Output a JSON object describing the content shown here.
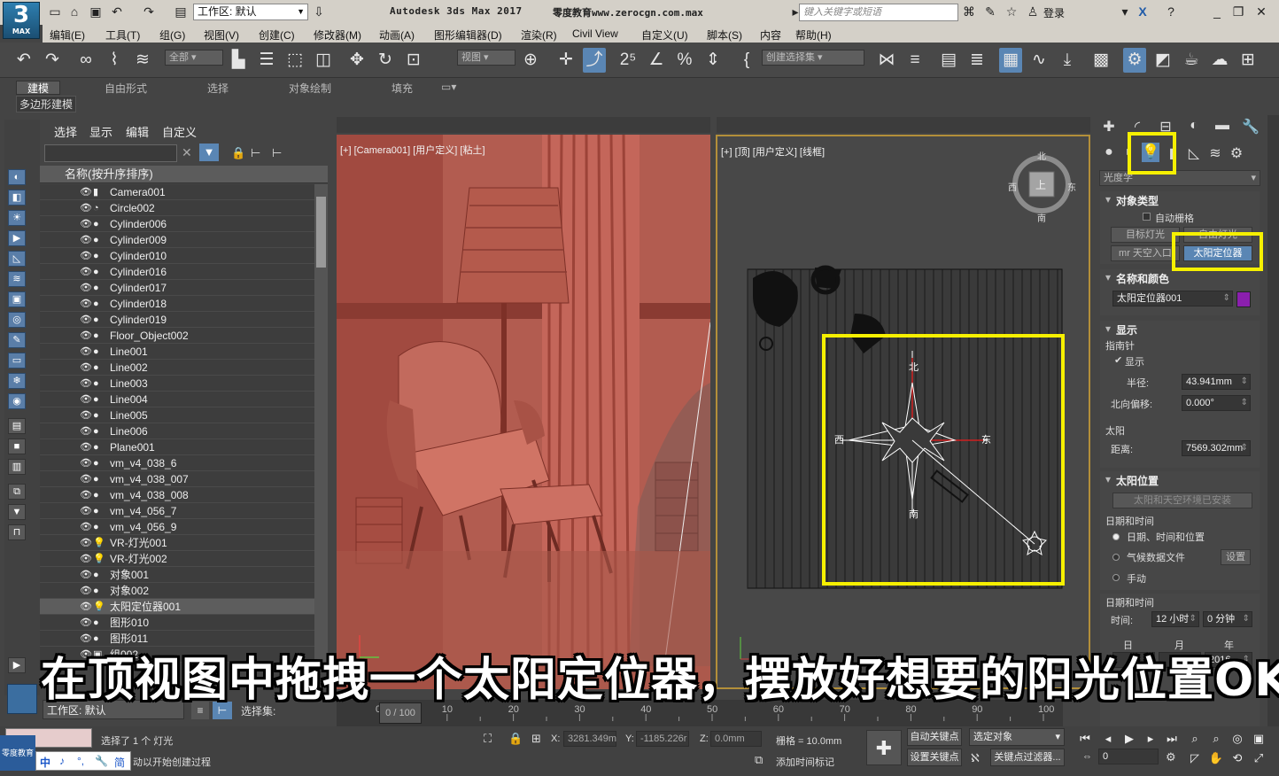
{
  "title_bar": {
    "logo_number": "3",
    "logo_sub": "MAX",
    "workspace_label": "工作区: 默认",
    "app_title": "Autodesk 3ds Max 2017",
    "site_title": "零度教育www.zerocgn.com.max",
    "search_placeholder": "键入关键字或短语",
    "login_label": "登录"
  },
  "menu": [
    "编辑(E)",
    "工具(T)",
    "组(G)",
    "视图(V)",
    "创建(C)",
    "修改器(M)",
    "动画(A)",
    "图形编辑器(D)",
    "渲染(R)",
    "Civil View",
    "自定义(U)",
    "脚本(S)",
    "内容",
    "帮助(H)"
  ],
  "toolbar": {
    "selection_filter": "全部",
    "coord_system": "视图",
    "selection_set": "创建选择集"
  },
  "ribbon": {
    "tabs": [
      "建模",
      "自由形式",
      "选择",
      "对象绘制",
      "填充"
    ],
    "active_tab": "建模",
    "sub_label": "多边形建模"
  },
  "explorer": {
    "menu": [
      "选择",
      "显示",
      "编辑",
      "自定义"
    ],
    "column_header": "名称(按升序排序)",
    "objects": [
      {
        "name": "Camera001",
        "type": "camera"
      },
      {
        "name": "Circle002",
        "type": "shape"
      },
      {
        "name": "Cylinder006",
        "type": "geometry"
      },
      {
        "name": "Cylinder009",
        "type": "geometry"
      },
      {
        "name": "Cylinder010",
        "type": "geometry"
      },
      {
        "name": "Cylinder016",
        "type": "geometry"
      },
      {
        "name": "Cylinder017",
        "type": "geometry"
      },
      {
        "name": "Cylinder018",
        "type": "geometry"
      },
      {
        "name": "Cylinder019",
        "type": "geometry"
      },
      {
        "name": "Floor_Object002",
        "type": "geometry"
      },
      {
        "name": "Line001",
        "type": "geometry"
      },
      {
        "name": "Line002",
        "type": "geometry"
      },
      {
        "name": "Line003",
        "type": "geometry"
      },
      {
        "name": "Line004",
        "type": "geometry"
      },
      {
        "name": "Line005",
        "type": "geometry"
      },
      {
        "name": "Line006",
        "type": "geometry"
      },
      {
        "name": "Plane001",
        "type": "geometry"
      },
      {
        "name": "vm_v4_038_6",
        "type": "geometry"
      },
      {
        "name": "vm_v4_038_007",
        "type": "geometry"
      },
      {
        "name": "vm_v4_038_008",
        "type": "geometry"
      },
      {
        "name": "vm_v4_056_7",
        "type": "geometry"
      },
      {
        "name": "vm_v4_056_9",
        "type": "geometry"
      },
      {
        "name": "VR-灯光001",
        "type": "light"
      },
      {
        "name": "VR-灯光002",
        "type": "light"
      },
      {
        "name": "对象001",
        "type": "geometry"
      },
      {
        "name": "对象002",
        "type": "geometry"
      },
      {
        "name": "太阳定位器001",
        "type": "light",
        "selected": true
      },
      {
        "name": "图形010",
        "type": "geometry"
      },
      {
        "name": "图形011",
        "type": "geometry"
      },
      {
        "name": "组002",
        "type": "group"
      }
    ]
  },
  "viewports": {
    "left_label": "[+] [Camera001] [用户定义] [粘土]",
    "right_label": "[+] [顶] [用户定义] [线框]",
    "viewcube": {
      "north": "北",
      "south": "南",
      "west": "西",
      "east": "东",
      "face": "上"
    },
    "compass": {
      "north": "北",
      "south": "南",
      "west": "西",
      "east": "东"
    }
  },
  "command_panel": {
    "category": "光度学",
    "object_type_title": "对象类型",
    "autogrid_label": "自动栅格",
    "buttons": [
      "目标灯光",
      "自由灯光",
      "mr 天空入口",
      "太阳定位器"
    ],
    "name_color_title": "名称和颜色",
    "object_name": "太阳定位器001",
    "object_color": "#8b1fae",
    "display_title": "显示",
    "compass_label": "指南针",
    "show_label": "显示",
    "radius_label": "半径:",
    "radius_value": "43.941mm",
    "north_offset_label": "北向偏移:",
    "north_offset_value": "0.000°",
    "sun_label": "太阳",
    "distance_label": "距离:",
    "distance_value": "7569.302mm",
    "sun_position_title": "太阳位置",
    "env_installed_label": "太阳和天空环境已安装",
    "date_time_label": "日期和时间",
    "opt_date_time_location": "日期、时间和位置",
    "opt_weather_file": "气候数据文件",
    "setup_label": "设置",
    "opt_manual": "手动",
    "date_time_sub": "日期和时间",
    "time_label": "时间:",
    "hour_value": "12 小时",
    "minute_value": "0 分钟",
    "day_label": "日",
    "month_label": "月",
    "year_label": "年",
    "year_value": "2016"
  },
  "timeline": {
    "frame_display": "0 / 100",
    "ticks": [
      "0",
      "10",
      "20",
      "30",
      "40",
      "50",
      "60",
      "70",
      "80",
      "90",
      "100"
    ],
    "workspace_bottom": "工作区: 默认",
    "selection_set_label": "选择集:"
  },
  "status": {
    "selected": "选择了 1 个 灯光",
    "prompt": "动以开始创建过程",
    "x_label": "X:",
    "x_value": "3281.349m",
    "y_label": "Y:",
    "y_value": "-1185.226r",
    "z_label": "Z:",
    "z_value": "0.0mm",
    "grid": "栅格 = 10.0mm",
    "add_time_tag": "添加时间标记",
    "auto_key": "自动关键点",
    "set_key": "设置关键点",
    "selected_object": "选定对象",
    "key_filters": "关键点过滤器...",
    "frame_value": "0",
    "ime_labels": [
      "中",
      "♪",
      "°,",
      "简"
    ],
    "watermark": "零度教育"
  },
  "subtitle": "在顶视图中拖拽一个太阳定位器，摆放好想要的阳光位置OK",
  "colors": {
    "highlight": "#f6f000",
    "selection": "#5a86b4",
    "clay": "#b25c50"
  }
}
